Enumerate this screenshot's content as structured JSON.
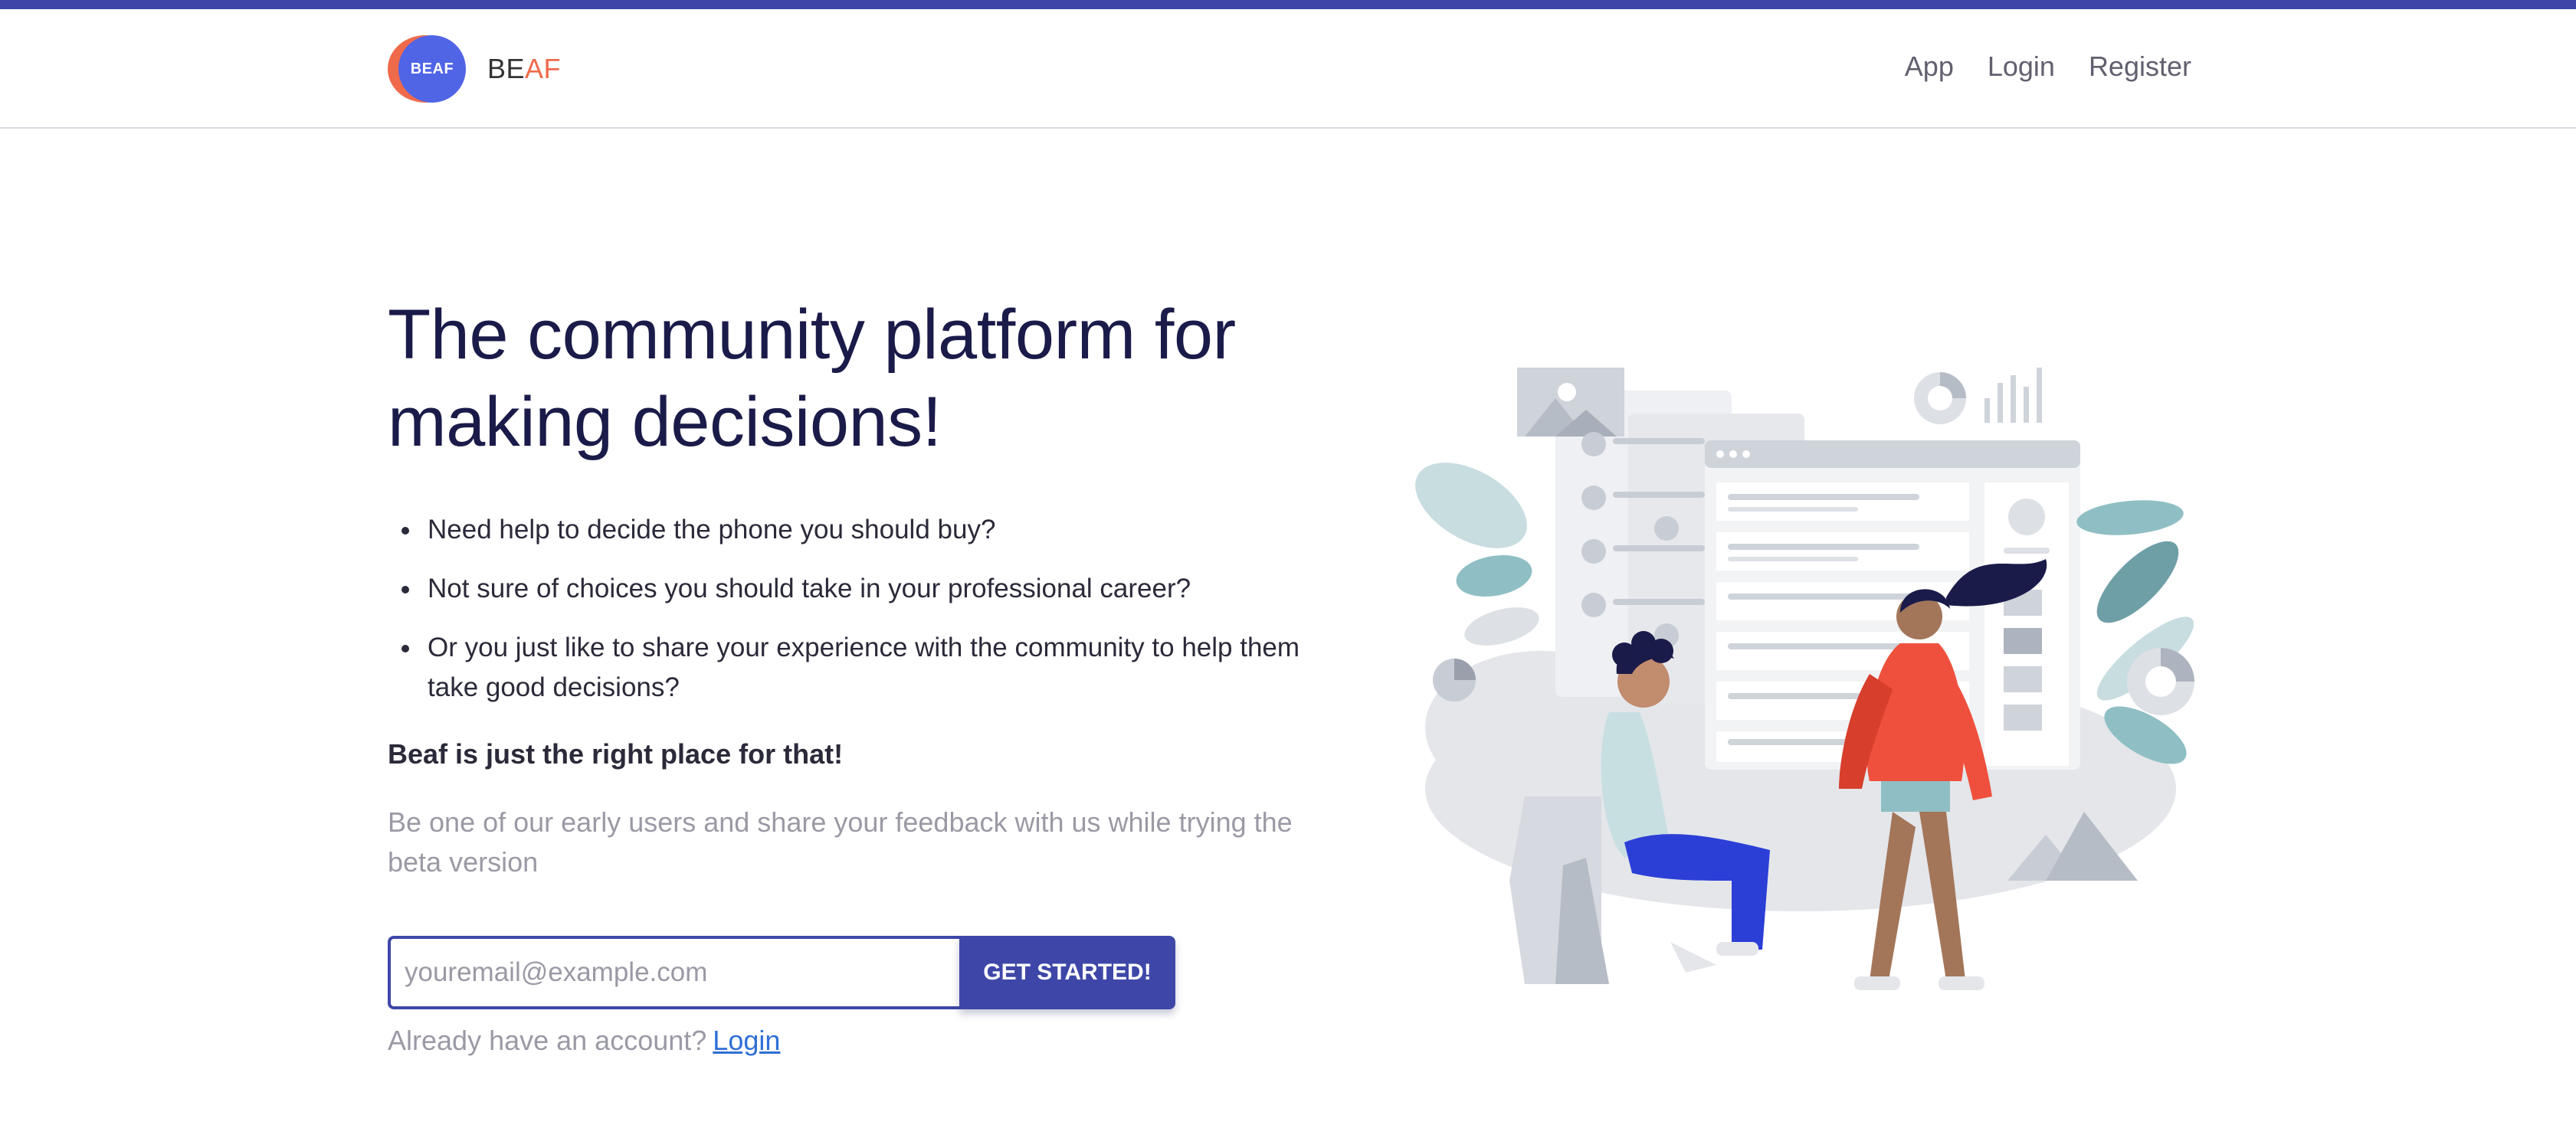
{
  "colors": {
    "primary": "#3e47a8",
    "accent": "#ef6a4a",
    "logo_blue": "#5064e6",
    "link": "#2f6fd6",
    "muted": "#9a9aa6"
  },
  "header": {
    "logo_text": "BEAF",
    "brand_prefix": "BE",
    "brand_suffix": "AF",
    "nav": {
      "app": "App",
      "login": "Login",
      "register": "Register"
    }
  },
  "hero": {
    "headline": "The community platform for making decisions!",
    "bullets": [
      "Need help to decide the phone you should buy?",
      "Not sure of choices you should take in your professional career?",
      "Or you just like to share your experience with the community to help them take good decisions?"
    ],
    "tagline": "Beaf is just the right place for that!",
    "subtext": "Be one of our early users and share your feedback with us while trying the beta version"
  },
  "signup": {
    "email_placeholder": "youremail@example.com",
    "email_value": "",
    "cta_label": "GET STARTED!",
    "login_prompt": "Already have an account?",
    "login_link": "Login"
  },
  "illustration": {
    "icon": "people-collaborating-illustration"
  }
}
